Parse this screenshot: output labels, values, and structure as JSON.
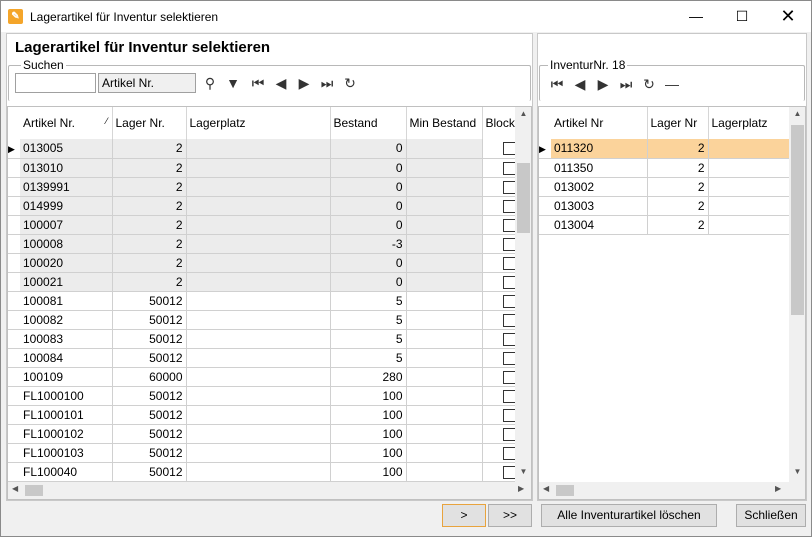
{
  "window": {
    "title": "Lagerartikel für Inventur selektieren"
  },
  "left": {
    "heading": "Lagerartikel für Inventur selektieren",
    "search_legend": "Suchen",
    "search_value": "",
    "search_field": "Artikel Nr.",
    "columns": [
      "Artikel Nr.",
      "Lager Nr.",
      "Lagerplatz",
      "Bestand",
      "Min Bestand",
      "Block"
    ],
    "rows": [
      {
        "artikel": "013005",
        "lager": "2",
        "platz": "",
        "bestand": "0",
        "min": ""
      },
      {
        "artikel": "013010",
        "lager": "2",
        "platz": "",
        "bestand": "0",
        "min": ""
      },
      {
        "artikel": "0139991",
        "lager": "2",
        "platz": "",
        "bestand": "0",
        "min": ""
      },
      {
        "artikel": "014999",
        "lager": "2",
        "platz": "",
        "bestand": "0",
        "min": ""
      },
      {
        "artikel": "100007",
        "lager": "2",
        "platz": "",
        "bestand": "0",
        "min": ""
      },
      {
        "artikel": "100008",
        "lager": "2",
        "platz": "",
        "bestand": "-3",
        "min": ""
      },
      {
        "artikel": "100020",
        "lager": "2",
        "platz": "",
        "bestand": "0",
        "min": ""
      },
      {
        "artikel": "100021",
        "lager": "2",
        "platz": "",
        "bestand": "0",
        "min": ""
      },
      {
        "artikel": "100081",
        "lager": "50012",
        "platz": "",
        "bestand": "5",
        "min": ""
      },
      {
        "artikel": "100082",
        "lager": "50012",
        "platz": "",
        "bestand": "5",
        "min": ""
      },
      {
        "artikel": "100083",
        "lager": "50012",
        "platz": "",
        "bestand": "5",
        "min": ""
      },
      {
        "artikel": "100084",
        "lager": "50012",
        "platz": "",
        "bestand": "5",
        "min": ""
      },
      {
        "artikel": "100109",
        "lager": "60000",
        "platz": "",
        "bestand": "280",
        "min": ""
      },
      {
        "artikel": "FL1000100",
        "lager": "50012",
        "platz": "",
        "bestand": "100",
        "min": ""
      },
      {
        "artikel": "FL1000101",
        "lager": "50012",
        "platz": "",
        "bestand": "100",
        "min": ""
      },
      {
        "artikel": "FL1000102",
        "lager": "50012",
        "platz": "",
        "bestand": "100",
        "min": ""
      },
      {
        "artikel": "FL1000103",
        "lager": "50012",
        "platz": "",
        "bestand": "100",
        "min": ""
      },
      {
        "artikel": "FL100040",
        "lager": "50012",
        "platz": "",
        "bestand": "100",
        "min": ""
      }
    ]
  },
  "right": {
    "legend": "InventurNr. 18",
    "columns": [
      "Artikel Nr",
      "Lager Nr",
      "Lagerplatz"
    ],
    "rows": [
      {
        "artikel": "011320",
        "lager": "2",
        "platz": ""
      },
      {
        "artikel": "011350",
        "lager": "2",
        "platz": ""
      },
      {
        "artikel": "013002",
        "lager": "2",
        "platz": ""
      },
      {
        "artikel": "013003",
        "lager": "2",
        "platz": ""
      },
      {
        "artikel": "013004",
        "lager": "2",
        "platz": ""
      }
    ]
  },
  "footer": {
    "add_label": ">",
    "add_all_label": ">>",
    "delete_all_label": "Alle Inventurartikel löschen",
    "close_label": "Schließen"
  },
  "colors": {
    "selected_row": "#fbd39b",
    "app_icon": "#f4a52a"
  }
}
